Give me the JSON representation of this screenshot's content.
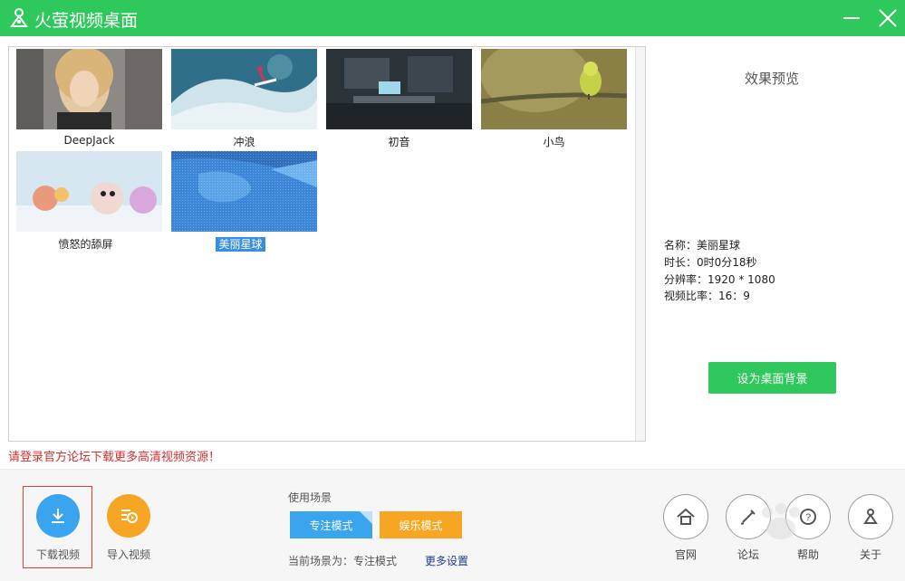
{
  "app": {
    "title": "火萤视频桌面"
  },
  "gallery": {
    "items": [
      {
        "label": "DeepJack",
        "selected": false
      },
      {
        "label": "冲浪",
        "selected": false
      },
      {
        "label": "初音",
        "selected": false
      },
      {
        "label": "小鸟",
        "selected": false
      },
      {
        "label": "愤怒的舔屏",
        "selected": false
      },
      {
        "label": "美丽星球",
        "selected": true
      }
    ]
  },
  "preview": {
    "title": "效果预览",
    "name_line": "名称：美丽星球",
    "duration_line": "时长：0时0分18秒",
    "resolution_line": "分辨率：1920 * 1080",
    "ratio_line": "视频比率：16：9",
    "set_bg_label": "设为桌面背景"
  },
  "notice": "请登录官方论坛下载更多高清视频资源！",
  "actions": {
    "download_label": "下载视频",
    "import_label": "导入视频"
  },
  "scene": {
    "label": "使用场景",
    "focus_label": "专注模式",
    "fun_label": "娱乐模式",
    "status": "当前场景为：专注模式",
    "more_settings": "更多设置"
  },
  "nav": {
    "items": [
      {
        "label": "官网"
      },
      {
        "label": "论坛"
      },
      {
        "label": "帮助"
      },
      {
        "label": "关于"
      }
    ]
  },
  "colors": {
    "brand_green": "#2fc85c",
    "accent_blue": "#3aa5ee",
    "accent_orange": "#f6a623",
    "notice_red": "#d0312d"
  }
}
